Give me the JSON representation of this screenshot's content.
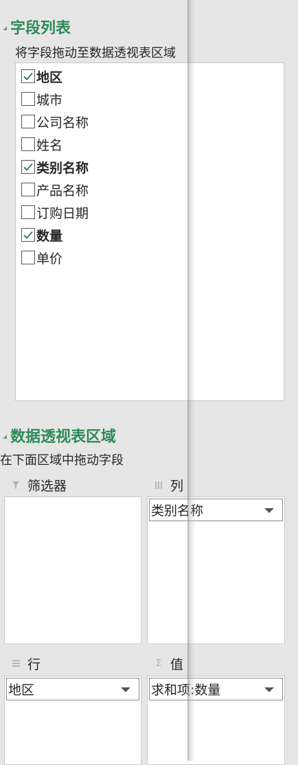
{
  "field_list": {
    "title": "字段列表",
    "hint": "将字段拖动至数据透视表区域",
    "fields": [
      {
        "label": "地区",
        "checked": true
      },
      {
        "label": "城市",
        "checked": false
      },
      {
        "label": "公司名称",
        "checked": false
      },
      {
        "label": "姓名",
        "checked": false
      },
      {
        "label": "类别名称",
        "checked": true
      },
      {
        "label": "产品名称",
        "checked": false
      },
      {
        "label": "订购日期",
        "checked": false
      },
      {
        "label": "数量",
        "checked": true
      },
      {
        "label": "单价",
        "checked": false
      }
    ]
  },
  "pivot_areas": {
    "title": "数据透视表区域",
    "hint": "在下面区域中拖动字段",
    "filters": {
      "label": "筛选器",
      "icon": "filter-icon",
      "items": []
    },
    "columns": {
      "label": "列",
      "icon": "columns-icon",
      "items": [
        "类别名称"
      ]
    },
    "rows": {
      "label": "行",
      "icon": "rows-icon",
      "items": [
        "地区"
      ]
    },
    "values": {
      "label": "值",
      "icon": "sigma-icon",
      "items": [
        "求和项:数量"
      ]
    }
  },
  "colors": {
    "accent": "#2e8b57",
    "check": "#2e8b57"
  }
}
